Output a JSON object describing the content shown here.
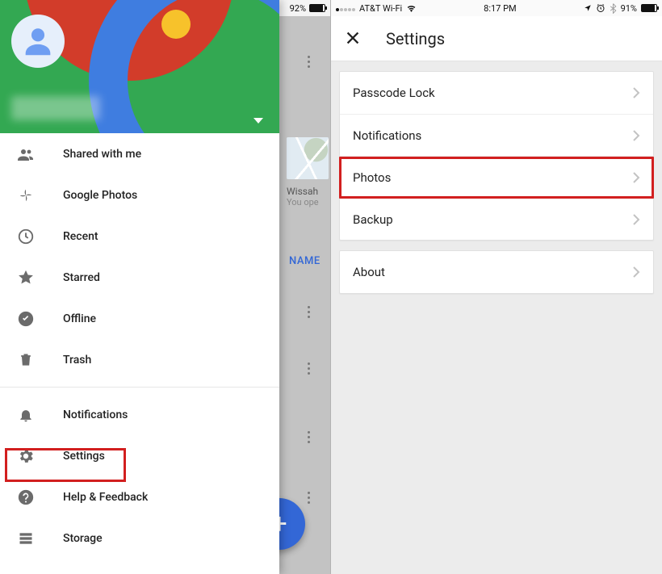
{
  "left": {
    "status": {
      "battery_pct": "92%"
    },
    "account_caret": true,
    "hidden_tile": {
      "title": "Wissah",
      "subtitle": "You ope"
    },
    "column_header": "NAME",
    "drawer": {
      "items": [
        {
          "key": "shared",
          "label": "Shared with me",
          "icon": "people-icon"
        },
        {
          "key": "gphotos",
          "label": "Google Photos",
          "icon": "pinwheel-icon"
        },
        {
          "key": "recent",
          "label": "Recent",
          "icon": "clock-icon"
        },
        {
          "key": "starred",
          "label": "Starred",
          "icon": "star-icon"
        },
        {
          "key": "offline",
          "label": "Offline",
          "icon": "check-circle-icon"
        },
        {
          "key": "trash",
          "label": "Trash",
          "icon": "trash-icon"
        }
      ],
      "items2": [
        {
          "key": "notifications",
          "label": "Notifications",
          "icon": "bell-icon"
        },
        {
          "key": "settings",
          "label": "Settings",
          "icon": "gear-icon",
          "highlighted": true
        },
        {
          "key": "help",
          "label": "Help & Feedback",
          "icon": "help-icon"
        },
        {
          "key": "storage",
          "label": "Storage",
          "icon": "storage-icon"
        }
      ]
    },
    "fab_glyph": "+"
  },
  "right": {
    "status": {
      "carrier": "AT&T Wi-Fi",
      "time": "8:17 PM",
      "battery_pct": "91%"
    },
    "title": "Settings",
    "group1": [
      {
        "key": "passcode",
        "label": "Passcode Lock"
      },
      {
        "key": "notifications",
        "label": "Notifications"
      },
      {
        "key": "photos",
        "label": "Photos",
        "highlighted": true
      },
      {
        "key": "backup",
        "label": "Backup"
      }
    ],
    "group2": [
      {
        "key": "about",
        "label": "About"
      }
    ]
  }
}
